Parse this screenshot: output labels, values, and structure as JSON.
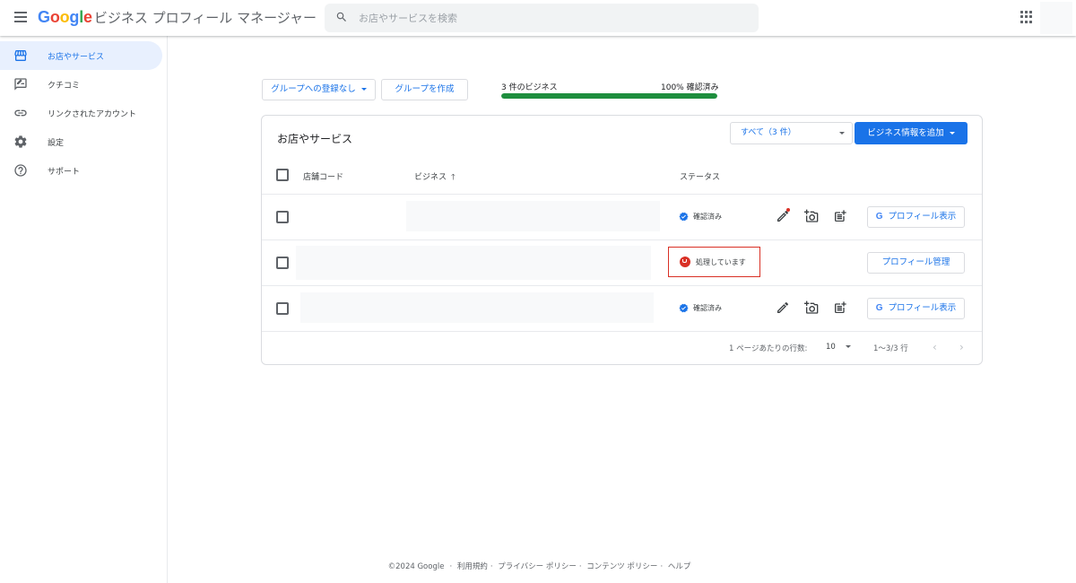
{
  "header": {
    "brand_google": "Google",
    "brand_product": "ビジネス プロフィール マネージャー",
    "search_placeholder": "お店やサービスを検索"
  },
  "sidebar": {
    "items": [
      {
        "label": "お店やサービス",
        "icon": "storefront-icon",
        "active": true
      },
      {
        "label": "クチコミ",
        "icon": "reviews-icon",
        "active": false
      },
      {
        "label": "リンクされたアカウント",
        "icon": "link-icon",
        "active": false
      },
      {
        "label": "設定",
        "icon": "gear-icon",
        "active": false
      },
      {
        "label": "サポート",
        "icon": "help-icon",
        "active": false
      }
    ]
  },
  "toolbar": {
    "group_dropdown": "グループへの登録なし",
    "create_group": "グループを作成",
    "business_count": "3 件のビジネス",
    "verified_pct_label": "100% 確認済み",
    "verified_fraction": 1.0
  },
  "card": {
    "title": "お店やサービス",
    "filter": "すべて（3 件）",
    "add_button": "ビジネス情報を追加",
    "columns": {
      "store_code": "店舗コード",
      "business": "ビジネス",
      "status": "ステータス"
    },
    "rows": [
      {
        "status": "確認済み",
        "status_kind": "verified",
        "button": "プロフィール表示"
      },
      {
        "status": "処理しています",
        "status_kind": "pending",
        "button": "プロフィール管理"
      },
      {
        "status": "確認済み",
        "status_kind": "verified",
        "button": "プロフィール表示"
      }
    ],
    "pagination": {
      "rows_per_page_label": "1 ページあたりの行数:",
      "rows_per_page": "10",
      "range": "1〜3/3 行"
    }
  },
  "footer": {
    "copyright": "©2024 Google",
    "links": [
      "利用規約",
      "プライバシー ポリシー",
      "コンテンツ ポリシー",
      "ヘルプ"
    ]
  },
  "colors": {
    "accent": "#1a73e8",
    "success": "#1e8e3e",
    "error": "#d93025"
  }
}
